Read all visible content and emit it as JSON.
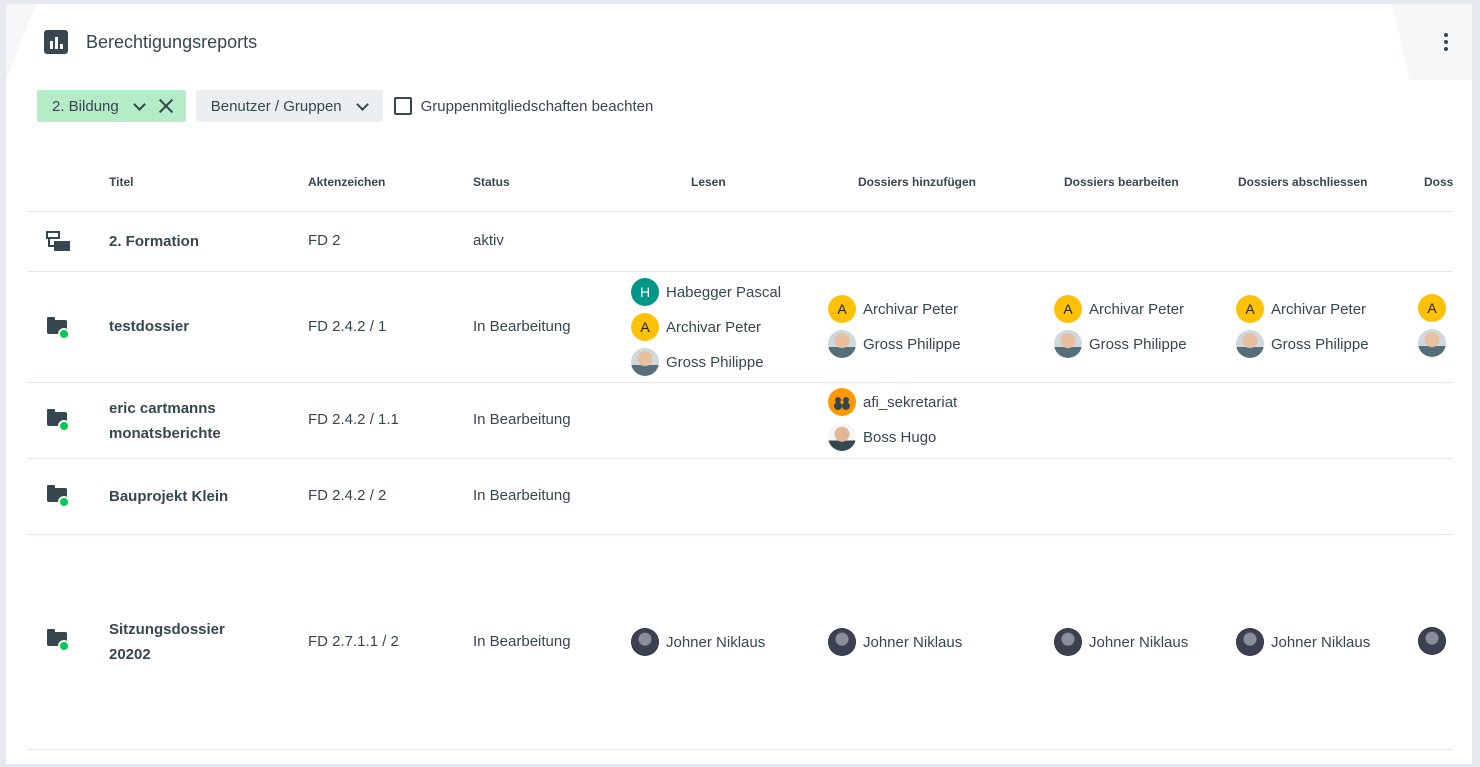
{
  "header": {
    "title": "Berechtigungsreports"
  },
  "filters": {
    "repository_chip": "2. Bildung",
    "principal_select": "Benutzer / Gruppen",
    "group_memberships_label": "Gruppenmitgliedschaften beachten"
  },
  "table": {
    "columns": [
      "Titel",
      "Aktenzeichen",
      "Status",
      "Lesen",
      "Dossiers hinzufügen",
      "Dossiers bearbeiten",
      "Dossiers abschliessen",
      "Doss"
    ],
    "rows": [
      {
        "title": "2. Formation",
        "reference": "FD 2",
        "status": "aktiv",
        "icon": "repository-folder-icon"
      },
      {
        "title": "testdossier",
        "reference": "FD 2.4.2 / 1",
        "status": "In Bearbeitung",
        "icon": "dossier-icon",
        "lesen": [
          {
            "initial": "H",
            "name": "Habegger Pascal"
          },
          {
            "initial": "A",
            "name": "Archivar Peter"
          },
          {
            "initial": "",
            "name": "Gross Philippe"
          }
        ],
        "hinzufuegen": [
          {
            "initial": "A",
            "name": "Archivar Peter"
          },
          {
            "initial": "",
            "name": "Gross Philippe"
          }
        ],
        "bearbeiten": [
          {
            "initial": "A",
            "name": "Archivar Peter"
          },
          {
            "initial": "",
            "name": "Gross Philippe"
          }
        ],
        "abschliessen": [
          {
            "initial": "A",
            "name": "Archivar Peter"
          },
          {
            "initial": "",
            "name": "Gross Philippe"
          }
        ],
        "cut": [
          {
            "initial": "A"
          }
        ]
      },
      {
        "title": "eric cartmanns monatsberichte",
        "reference": "FD 2.4.2 / 1.1",
        "status": "In Bearbeitung",
        "icon": "dossier-icon",
        "hinzufuegen": [
          {
            "initial": "",
            "name": "afi_sekretariat"
          },
          {
            "initial": "",
            "name": "Boss Hugo"
          }
        ]
      },
      {
        "title": "Bauprojekt Klein",
        "reference": "FD 2.4.2 / 2",
        "status": "In Bearbeitung",
        "icon": "dossier-icon"
      },
      {
        "title": "Sitzungsdossier 20202",
        "reference": "FD 2.7.1.1 / 2",
        "status": "In Bearbeitung",
        "icon": "dossier-icon",
        "lesen": [
          {
            "name": "Johner Niklaus"
          }
        ],
        "hinzufuegen": [
          {
            "name": "Johner Niklaus"
          }
        ],
        "bearbeiten": [
          {
            "name": "Johner Niklaus"
          }
        ],
        "abschliessen": [
          {
            "name": "Johner Niklaus"
          }
        ]
      }
    ]
  },
  "colors": {
    "accent_chip": "#b3ecc6",
    "status_dot": "#00c853",
    "teal_avatar": "#009688",
    "amber_avatar": "#ffc107"
  }
}
